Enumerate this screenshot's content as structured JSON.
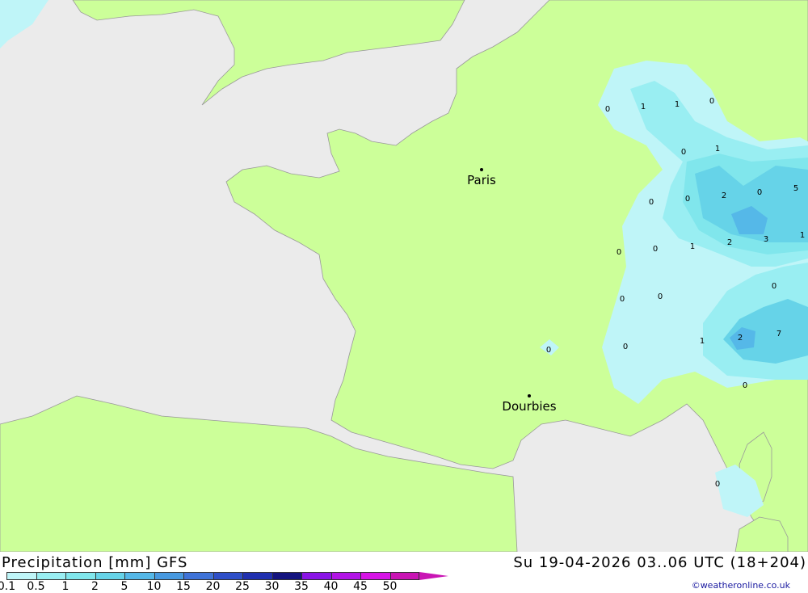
{
  "map": {
    "cities": [
      {
        "name": "Paris"
      },
      {
        "name": "Dourbies"
      }
    ],
    "values": [
      "0",
      "1",
      "1",
      "0",
      "0",
      "1",
      "0",
      "2",
      "0",
      "5",
      "3",
      "1",
      "0",
      "0",
      "1",
      "2",
      "0",
      "0",
      "0",
      "0",
      "2",
      "7",
      "1",
      "0",
      "0",
      "0",
      "0"
    ]
  },
  "footer": {
    "title": "Precipitation [mm] GFS",
    "date": "Su 19-04-2026 03..06 UTC (18+204)",
    "credit": "©weatheronline.co.uk"
  },
  "legend": {
    "ticks": [
      "0.1",
      "0.5",
      "1",
      "2",
      "5",
      "10",
      "15",
      "20",
      "25",
      "30",
      "35",
      "40",
      "45",
      "50"
    ],
    "colors": [
      "#bff5f8",
      "#99eef2",
      "#80e6ec",
      "#66d3e8",
      "#55b8e8",
      "#4799e0",
      "#3f73d8",
      "#2e4fc8",
      "#2030b0",
      "#14147f",
      "#8a14e6",
      "#b214e6",
      "#d614e6",
      "#c914b4"
    ]
  }
}
